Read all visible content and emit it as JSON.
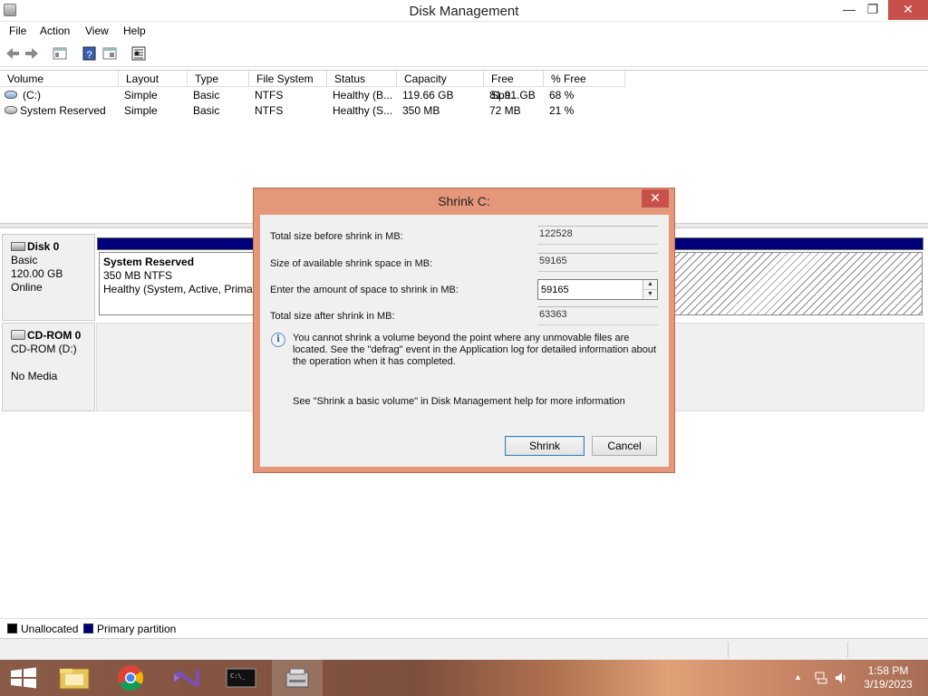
{
  "window": {
    "title": "Disk Management",
    "minimize": "—",
    "maximize": "❐",
    "close": "✕"
  },
  "menu": [
    "File",
    "Action",
    "View",
    "Help"
  ],
  "toolbar_icons": [
    "back-icon",
    "forward-icon",
    "properties-icon",
    "help-icon",
    "console-icon",
    "settings-icon"
  ],
  "volume_list": {
    "columns": [
      "Volume",
      "Layout",
      "Type",
      "File System",
      "Status",
      "Capacity",
      "Free Spa...",
      "% Free"
    ],
    "rows": [
      [
        "(C:)",
        "Simple",
        "Basic",
        "NTFS",
        "Healthy (B...",
        "119.66 GB",
        "81.91 GB",
        "68 %"
      ],
      [
        "System Reserved",
        "Simple",
        "Basic",
        "NTFS",
        "Healthy (S...",
        "350 MB",
        "72 MB",
        "21 %"
      ]
    ]
  },
  "disks": {
    "disk0": {
      "name": "Disk 0",
      "type": "Basic",
      "size": "120.00 GB",
      "status": "Online",
      "partition": {
        "name": "System Reserved",
        "size": "350 MB NTFS",
        "status": "Healthy (System, Active, Primar"
      }
    },
    "cdrom0": {
      "name": "CD-ROM 0",
      "drive": "CD-ROM (D:)",
      "media": "No Media"
    }
  },
  "legend": {
    "unallocated": "Unallocated",
    "primary": "Primary partition",
    "unallocated_color": "#000000",
    "primary_color": "#00007a"
  },
  "dialog": {
    "title": "Shrink C:",
    "close": "✕",
    "total_before_label": "Total size before shrink in MB:",
    "total_before_value": "122528",
    "available_label": "Size of available shrink space in MB:",
    "available_value": "59165",
    "amount_label": "Enter the amount of space to shrink in MB:",
    "amount_value": "59165",
    "total_after_label": "Total size after shrink in MB:",
    "total_after_value": "63363",
    "info_text": "You cannot shrink a volume beyond the point where any unmovable files are located. See the \"defrag\" event in the Application log for detailed information about the operation when it has completed.",
    "help_text": "See \"Shrink a basic volume\" in Disk Management help for more information",
    "shrink_button": "Shrink",
    "cancel_button": "Cancel"
  },
  "taskbar": {
    "apps": [
      "file-explorer-icon",
      "chrome-icon",
      "visual-studio-icon",
      "command-prompt-icon",
      "disk-management-icon"
    ],
    "time": "1:58 PM",
    "date": "3/19/2023"
  }
}
